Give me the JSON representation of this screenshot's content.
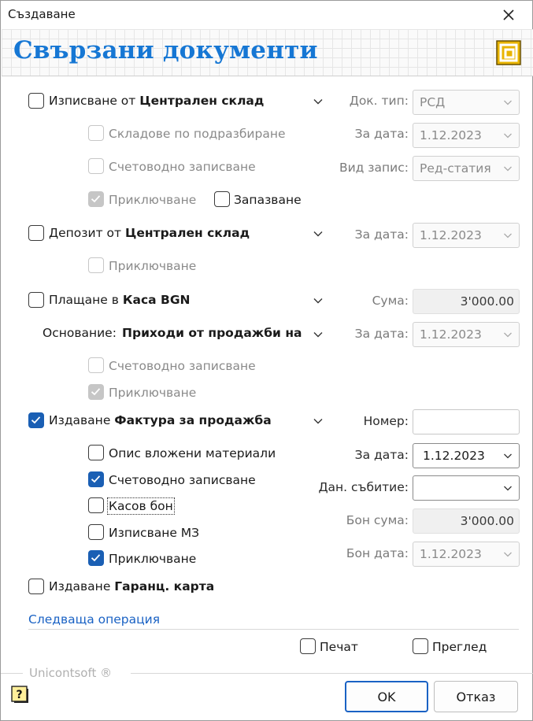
{
  "window": {
    "title": "Създаване"
  },
  "banner": {
    "heading": "Свързани документи"
  },
  "section1": {
    "label_prefix": "Изписване от",
    "label_bold": "Централен склад",
    "opt_default_stores": "Складове по подразбиране",
    "opt_accounting": "Счетоводно записване",
    "opt_finish": "Приключване",
    "opt_save": "Запазване",
    "doc_type_label": "Док. тип:",
    "doc_type_value": "РСД",
    "date_label": "За дата:",
    "date_value": "1.12.2023",
    "entry_type_label": "Вид запис:",
    "entry_type_value": "Ред-статия"
  },
  "section2": {
    "label_prefix": "Депозит от",
    "label_bold": "Централен склад",
    "opt_finish": "Приключване",
    "date_label": "За дата:",
    "date_value": "1.12.2023"
  },
  "section3": {
    "label_prefix": "Плащане в",
    "label_bold": "Каса BGN",
    "basis_label": "Основание:",
    "basis_value": "Приходи от продажби на с",
    "opt_accounting": "Счетоводно записване",
    "opt_finish": "Приключване",
    "amount_label": "Сума:",
    "amount_value": "3'000.00",
    "date_label": "За дата:",
    "date_value": "1.12.2023"
  },
  "section4": {
    "label_prefix": "Издаване",
    "label_bold": "Фактура за продажба",
    "opt_materials": "Опис вложени материали",
    "opt_accounting": "Счетоводно записване",
    "opt_cash_receipt": "Касов бон",
    "opt_write_off": "Изписване МЗ",
    "opt_finish": "Приключване",
    "number_label": "Номер:",
    "number_value": "",
    "date_label": "За дата:",
    "date_value": "1.12.2023",
    "tax_event_label": "Дан. събитие:",
    "tax_event_value": "",
    "receipt_amount_label": "Бон сума:",
    "receipt_amount_value": "3'000.00",
    "receipt_date_label": "Бон дата:",
    "receipt_date_value": "1.12.2023"
  },
  "section5": {
    "label_prefix": "Издаване",
    "label_bold": "Гаранц. карта"
  },
  "next_operation": "Следваща операция",
  "print_label": "Печат",
  "preview_label": "Преглед",
  "vendor": "Unicontsoft ®",
  "buttons": {
    "ok": "OK",
    "cancel": "Отказ"
  },
  "colors": {
    "accent": "#1a5fb4",
    "heading": "#1677d4",
    "link": "#1a62c4",
    "logo": "#e8b400"
  }
}
